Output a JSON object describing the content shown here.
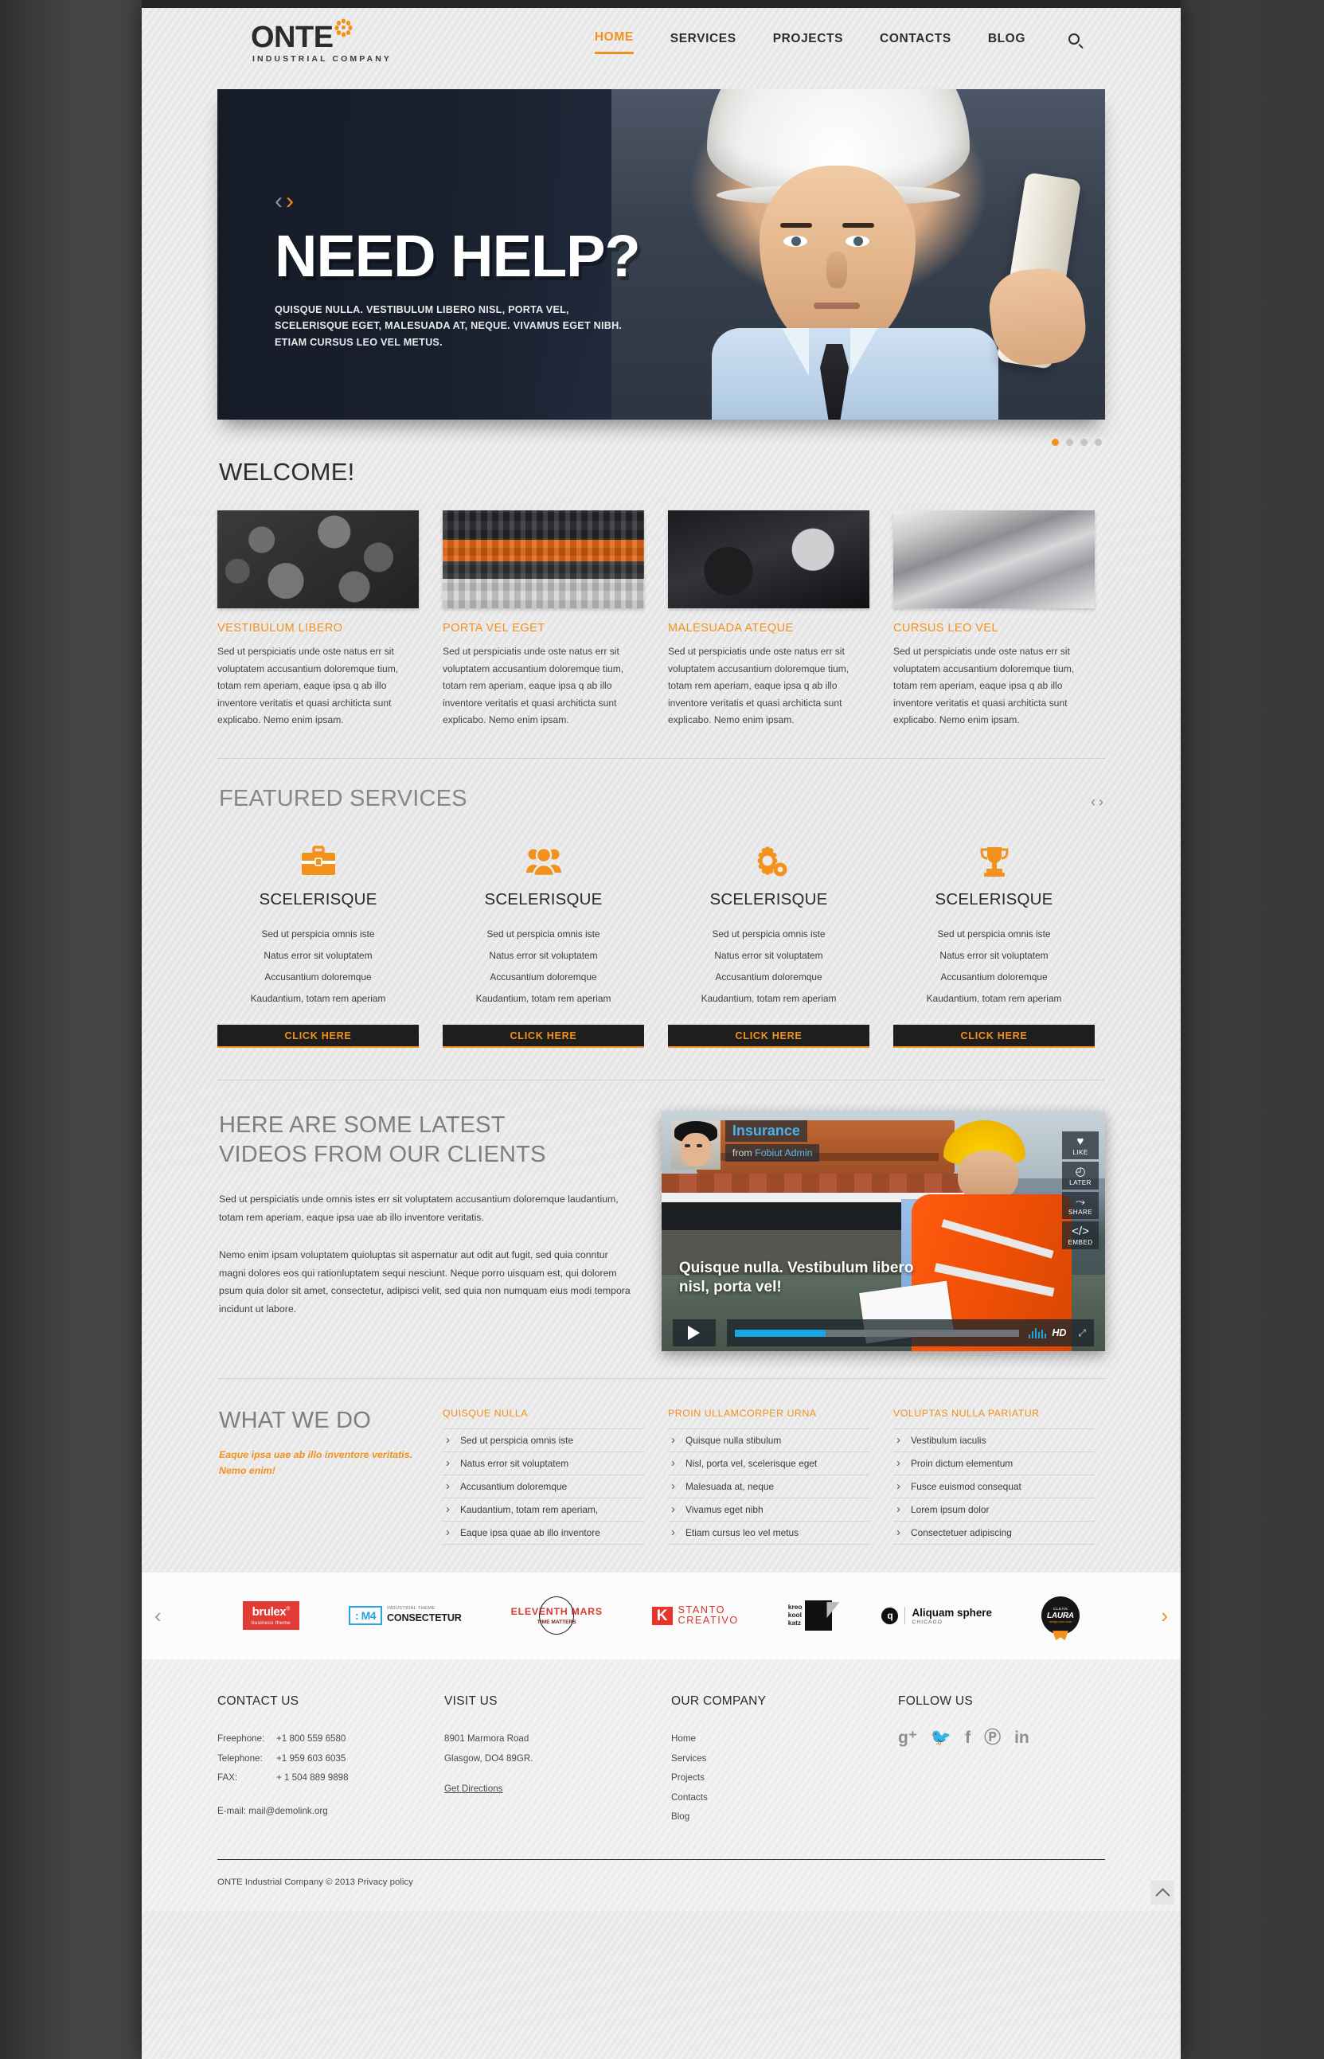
{
  "header": {
    "logo_word": "ONTE",
    "logo_sub": "INDUSTRIAL COMPANY",
    "nav": [
      {
        "label": "HOME",
        "active": true
      },
      {
        "label": "SERVICES",
        "active": false
      },
      {
        "label": "PROJECTS",
        "active": false
      },
      {
        "label": "CONTACTS",
        "active": false
      },
      {
        "label": "BLOG",
        "active": false
      }
    ],
    "search_icon": "search-icon"
  },
  "hero": {
    "title": "NEED HELP?",
    "subtitle": "QUISQUE NULLA. VESTIBULUM LIBERO NISL, PORTA VEL, SCELERISQUE EGET, MALESUADA AT, NEQUE. VIVAMUS EGET NIBH. ETIAM CURSUS LEO VEL METUS.",
    "prev_arrow": "‹",
    "next_arrow": "›"
  },
  "welcome": {
    "heading": "WELCOME!",
    "dots": 4,
    "active_dot": 0,
    "cards": [
      {
        "title": "VESTIBULUM LIBERO",
        "text": "Sed ut perspiciatis unde oste natus err sit voluptatem accusantium doloremque tium, totam rem aperiam, eaque ipsa q ab illo inventore veritatis et quasi architicta sunt explicabo. Nemo enim ipsam.",
        "thumb": "coal-pile-image"
      },
      {
        "title": "PORTA VEL EGET",
        "text": "Sed ut perspiciatis unde oste natus err sit voluptatem accusantium doloremque tium, totam rem aperiam, eaque ipsa q ab illo inventore veritatis et quasi architicta sunt explicabo. Nemo enim ipsam.",
        "thumb": "factory-plant-image"
      },
      {
        "title": "MALESUADA ATEQUE",
        "text": "Sed ut perspiciatis unde oste natus err sit voluptatem accusantium doloremque tium, totam rem aperiam, eaque ipsa q ab illo inventore veritatis et quasi architicta sunt explicabo. Nemo enim ipsam.",
        "thumb": "machinery-image"
      },
      {
        "title": "CURSUS LEO VEL",
        "text": "Sed ut perspiciatis unde oste natus err sit voluptatem accusantium doloremque tium, totam rem aperiam, eaque ipsa q ab illo inventore veritatis et quasi architicta sunt explicabo. Nemo enim ipsam.",
        "thumb": "metal-rolls-image"
      }
    ]
  },
  "featured_services": {
    "heading": "FEATURED SERVICES",
    "prev_arrow": "‹",
    "next_arrow": "›",
    "items": [
      {
        "icon": "briefcase-icon",
        "title": "SCELERISQUE",
        "lines": [
          "Sed ut perspicia omnis iste",
          "Natus error sit voluptatem",
          "Accusantium doloremque",
          "Kaudantium, totam rem aperiam"
        ],
        "button": "CLICK HERE"
      },
      {
        "icon": "people-group-icon",
        "title": "SCELERISQUE",
        "lines": [
          "Sed ut perspicia omnis iste",
          "Natus error sit voluptatem",
          "Accusantium doloremque",
          "Kaudantium, totam rem aperiam"
        ],
        "button": "CLICK HERE"
      },
      {
        "icon": "gears-icon",
        "title": "SCELERISQUE",
        "lines": [
          "Sed ut perspicia omnis iste",
          "Natus error sit voluptatem",
          "Accusantium doloremque",
          "Kaudantium, totam rem aperiam"
        ],
        "button": "CLICK HERE"
      },
      {
        "icon": "trophy-icon",
        "title": "SCELERISQUE",
        "lines": [
          "Sed ut perspicia omnis iste",
          "Natus error sit voluptatem",
          "Accusantium doloremque",
          "Kaudantium, totam rem aperiam"
        ],
        "button": "CLICK HERE"
      }
    ]
  },
  "videos": {
    "heading_line1": "HERE ARE SOME LATEST",
    "heading_line2": "VIDEOS FROM OUR CLIENTS",
    "paragraph1": "Sed ut perspiciatis unde omnis istes err sit voluptatem accusantium doloremque laudantium, totam rem aperiam, eaque ipsa uae ab illo inventore veritatis.",
    "paragraph2": "Nemo enim ipsam voluptatem quioluptas sit aspernatur aut odit aut fugit, sed quia conntur magni dolores eos qui rationluptatem sequi nesciunt. Neque porro uisquam est, qui dolorem psum quia dolor sit amet, consectetur, adipisci velit, sed quia non numquam eius modi tempora incidunt ut labore.",
    "player": {
      "title": "Insurance",
      "from_label": "from",
      "from_user": "Fobiut Admin",
      "caption": "Quisque nulla. Vestibulum libero nisl, porta vel!",
      "side_buttons": [
        {
          "glyph": "♥",
          "label": "LIKE",
          "icon": "heart-icon"
        },
        {
          "glyph": "◴",
          "label": "LATER",
          "icon": "clock-icon"
        },
        {
          "glyph": "⤳",
          "label": "SHARE",
          "icon": "share-icon"
        },
        {
          "glyph": "</>",
          "label": "EMBED",
          "icon": "embed-icon"
        }
      ],
      "play_icon": "play-icon",
      "hd_label": "HD",
      "fullscreen_icon": "fullscreen-icon",
      "progress_percent": 32
    }
  },
  "what_we_do": {
    "heading": "WHAT WE DO",
    "tagline": "Eaque ipsa uae ab illo inventore veritatis. Nemo enim!",
    "columns": [
      {
        "title": "QUISQUE NULLA",
        "items": [
          "Sed ut perspicia omnis iste",
          "Natus error sit voluptatem",
          "Accusantium doloremque",
          "Kaudantium, totam rem aperiam,",
          "Eaque ipsa quae ab illo inventore"
        ]
      },
      {
        "title": "PROIN ULLAMCORPER URNA",
        "items": [
          "Quisque nulla  stibulum",
          "Nisl, porta vel, scelerisque eget",
          "Malesuada at, neque",
          "Vivamus eget nibh",
          "Etiam cursus leo vel metus"
        ]
      },
      {
        "title": "VOLUPTAS NULLA PARIATUR",
        "items": [
          "Vestibulum iaculis",
          "Proin dictum elementum",
          "Fusce euismod consequat",
          "Lorem ipsum dolor",
          "Consectetuer adipiscing"
        ]
      }
    ]
  },
  "partners": {
    "prev_arrow": "‹",
    "next_arrow": "›",
    "logos": [
      {
        "name": "brulex",
        "line1": "brulex",
        "line2": "business theme",
        "mark": "®"
      },
      {
        "name": "m4-consectetur",
        "badge": ": M4",
        "small": "INDUSTRIAL THEME",
        "line1": "CONSECTETUR"
      },
      {
        "name": "eleventh-mars",
        "line1": "ELEVENTH MARS",
        "line2": "TIME MATTERS"
      },
      {
        "name": "stanto-creativo",
        "badge": "K",
        "line1": "STANTO",
        "line2": "CREATIVO"
      },
      {
        "name": "kreo-kool-katz",
        "line1": "kreo",
        "line2": "kool",
        "line3": "katz"
      },
      {
        "name": "aliquam-sphere",
        "badge": "q",
        "line1": "Aliquam sphere",
        "line2": "CHICAGO"
      },
      {
        "name": "clean-laura",
        "small": "CLEAN",
        "line1": "LAURA",
        "line2": "design your work"
      }
    ]
  },
  "footer": {
    "contact": {
      "title": "CONTACT US",
      "rows": [
        {
          "label": "Freephone:",
          "value": "+1 800 559 6580"
        },
        {
          "label": "Telephone:",
          "value": "+1 959 603 6035"
        },
        {
          "label": "FAX:",
          "value": "+ 1 504 889 9898"
        }
      ],
      "email": "E-mail: mail@demolink.org"
    },
    "visit": {
      "title": "VISIT US",
      "address_line1": "8901 Marmora Road",
      "address_line2": "Glasgow, DO4 89GR.",
      "link": "Get Directions"
    },
    "company": {
      "title": "OUR COMPANY",
      "links": [
        "Home",
        "Services",
        "Projects",
        "Contacts",
        "Blog"
      ]
    },
    "follow": {
      "title": "FOLLOW US",
      "socials": [
        {
          "icon": "google-plus-icon",
          "glyph": "g⁺"
        },
        {
          "icon": "twitter-icon",
          "glyph": "🐦"
        },
        {
          "icon": "facebook-icon",
          "glyph": "f"
        },
        {
          "icon": "pinterest-icon",
          "glyph": "Ⓟ"
        },
        {
          "icon": "linkedin-icon",
          "glyph": "in"
        }
      ]
    },
    "copyright": "ONTE Industrial Company © 2013 Privacy policy",
    "scroll_top_icon": "scroll-to-top-icon"
  },
  "colors": {
    "accent": "#f2911b",
    "dark": "#1e1e1e",
    "body_text": "#3f3f3f",
    "heading_gray": "#7e7e7e"
  }
}
